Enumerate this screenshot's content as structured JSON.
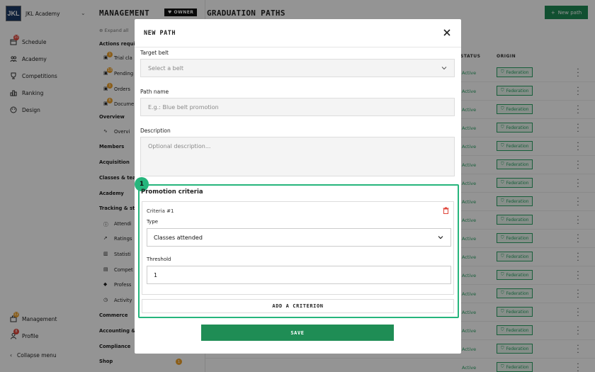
{
  "brand": {
    "logo": "JKL",
    "name": "JKL Academy"
  },
  "leftnav": {
    "items": [
      {
        "label": "Schedule",
        "icon": "calendar-icon",
        "badge": "10"
      },
      {
        "label": "Academy",
        "icon": "users-icon",
        "badge": ""
      },
      {
        "label": "Competitions",
        "icon": "trophy-icon",
        "badge": ""
      },
      {
        "label": "Ranking",
        "icon": "ranking-icon",
        "badge": ""
      },
      {
        "label": "Design",
        "icon": "palette-icon",
        "badge": ""
      }
    ],
    "bottom": [
      {
        "label": "Management",
        "icon": "briefcase-icon",
        "badge": "12"
      },
      {
        "label": "Profile",
        "icon": "user-icon",
        "badge": "8"
      }
    ],
    "collapse": "Collapse menu"
  },
  "secnav": {
    "title": "MANAGEMENT",
    "owner": "OWNER",
    "expand": "Expand all",
    "actions_group": "Actions requir",
    "actions": [
      {
        "label": "Trial cla",
        "badge": "1"
      },
      {
        "label": "Pending",
        "badge": "10"
      },
      {
        "label": "Orders",
        "badge": "1"
      },
      {
        "label": "Docume",
        "badge": "6"
      }
    ],
    "overview_group": "Overview",
    "overview_item": "Overvi",
    "groups": [
      "Members",
      "Acquisition",
      "Classes & tea",
      "Academy",
      "Tracking & st"
    ],
    "tracking": [
      "Attendi",
      "Ratings",
      "Statisti",
      "Compet",
      "Profess",
      "Activity"
    ],
    "groups2": [
      "Commerce",
      "Accounting &",
      "Compliance"
    ],
    "shop": "Shop",
    "shop_badge": "1"
  },
  "main": {
    "title": "GRADUATION PATHS",
    "new_button": "New path",
    "columns": {
      "status": "STATUS",
      "origin": "ORIGIN"
    },
    "row_status": "Active",
    "row_origin": "Federation"
  },
  "modal": {
    "title": "NEW PATH",
    "target_belt_label": "Target belt",
    "target_belt_placeholder": "Select a belt",
    "path_name_label": "Path name",
    "path_name_placeholder": "E.g.: Blue belt promotion",
    "description_label": "Description",
    "description_placeholder": "Optional description...",
    "step": "1",
    "criteria_title": "Promotion criteria",
    "criteria": {
      "title": "Criteria #1",
      "type_label": "Type",
      "type_value": "Classes attended",
      "threshold_label": "Threshold",
      "threshold_value": "1"
    },
    "add_criterion": "ADD A CRITERION",
    "save": "SAVE"
  },
  "colors": {
    "accent": "#1e8a55",
    "highlight": "#26b57c",
    "badge": "#e0453a",
    "badge_orange": "#f0a22b",
    "active": "#2aa365"
  }
}
